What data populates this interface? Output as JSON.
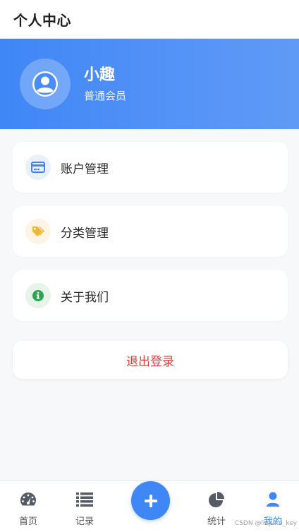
{
  "header": {
    "title": "个人中心"
  },
  "profile": {
    "name": "小趣",
    "level": "普通会员",
    "avatar_icon": "user-circle-icon"
  },
  "menu": [
    {
      "label": "账户管理",
      "icon": "credit-card-icon",
      "icon_color": "#3f86f6",
      "icon_bg": "#eaf1fe"
    },
    {
      "label": "分类管理",
      "icon": "tags-icon",
      "icon_color": "#f2b632",
      "icon_bg": "#fdf4e3"
    },
    {
      "label": "关于我们",
      "icon": "info-circle-icon",
      "icon_color": "#2ea44f",
      "icon_bg": "#e6f4ea"
    }
  ],
  "logout": {
    "label": "退出登录",
    "color": "#d9423a"
  },
  "tabbar": {
    "items": [
      {
        "label": "首页",
        "icon": "dashboard-icon"
      },
      {
        "label": "记录",
        "icon": "list-icon"
      },
      {
        "label": "",
        "icon": "plus-icon"
      },
      {
        "label": "统计",
        "icon": "pie-chart-icon"
      },
      {
        "label": "我的",
        "icon": "user-icon",
        "active": true
      }
    ],
    "accent": "#3f86f6"
  },
  "watermark": "CSDN @liujunn_key"
}
